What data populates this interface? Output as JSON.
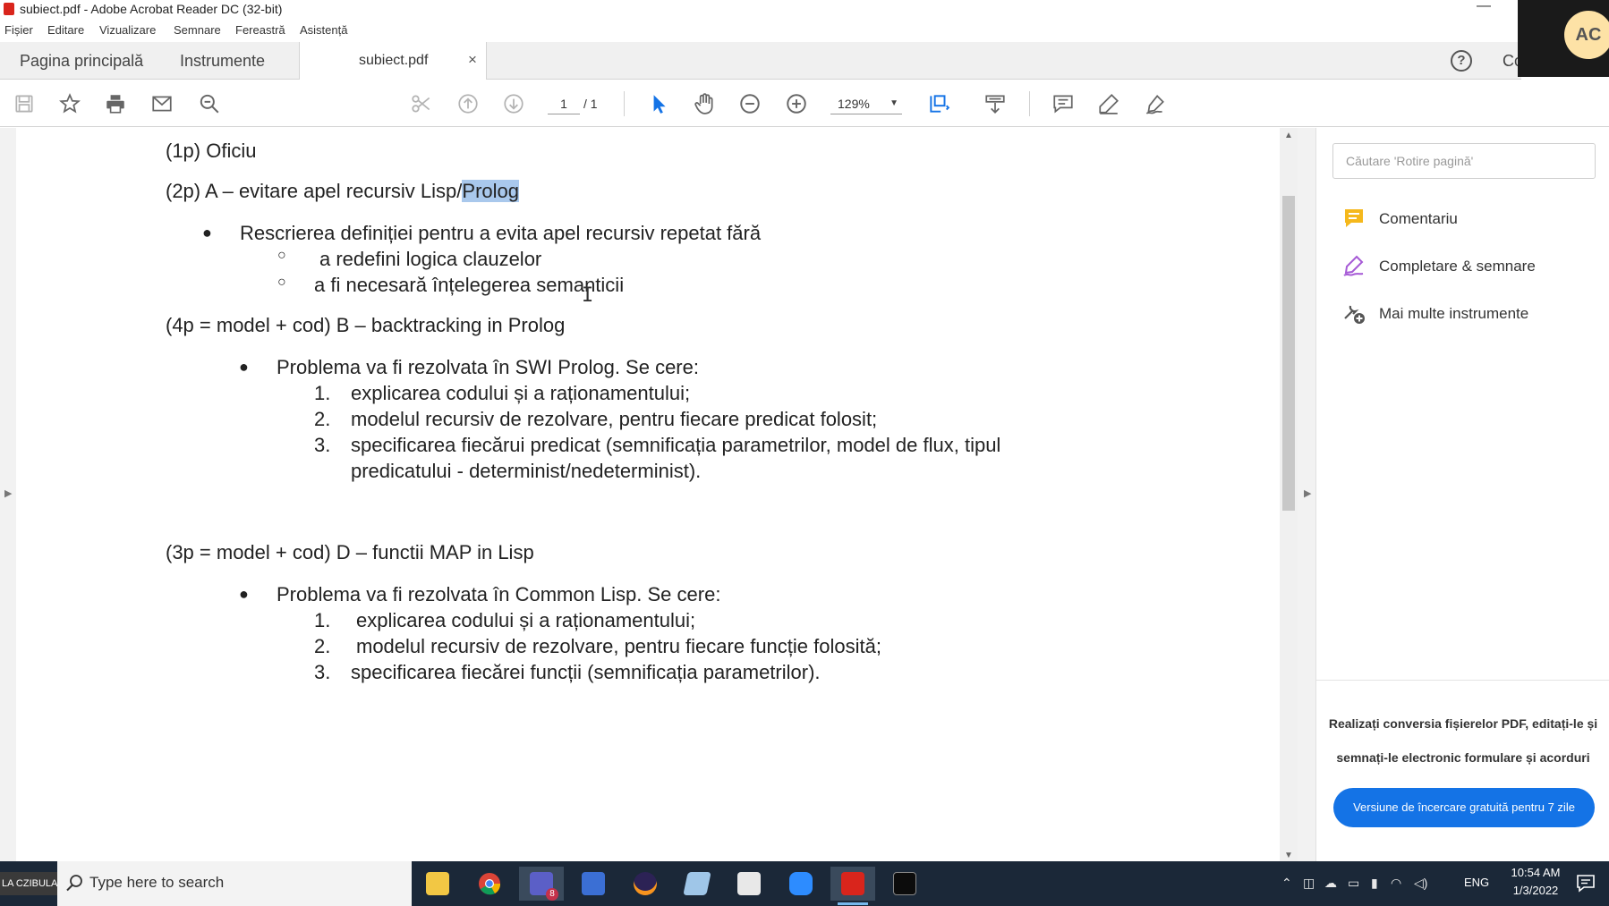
{
  "window": {
    "title": "subiect.pdf - Adobe Acrobat Reader DC (32-bit)",
    "minimize": "—"
  },
  "menu": [
    "Fișier",
    "Editare",
    "Vizualizare",
    "Semnare",
    "Fereastră",
    "Asistență"
  ],
  "tabs": {
    "home": "Pagina principală",
    "tools": "Instrumente",
    "document": "subiect.pdf",
    "close": "×",
    "overflow": "Co"
  },
  "help_icon": "?",
  "avatar_initials": "AC",
  "toolbar": {
    "icons": [
      "save-icon",
      "bookmark-star-icon",
      "print-icon",
      "email-icon",
      "search-zoom-icon",
      "scissors-icon",
      "page-up-icon",
      "page-down-icon",
      "select-cursor-icon",
      "hand-icon",
      "zoom-out-icon",
      "zoom-in-icon",
      "fit-page-icon",
      "scroll-mode-icon",
      "comment-icon",
      "highlight-pen-icon",
      "sign-icon"
    ],
    "page_current": "1",
    "page_total": "/ 1",
    "zoom": "129%",
    "accent": "#1473e6"
  },
  "document": {
    "lines": {
      "l1": "(1p) Oficiu",
      "l2_pre": "(2p) A – evitare apel recursiv Lisp/",
      "l2_hl": "Prolog",
      "l3": "Rescrierea definiției pentru a evita apel recursiv repetat fără",
      "l4": "a redefini logica clauzelor",
      "l5": "a fi necesară înțelegerea semanticii",
      "l6": "(4p =  model + cod) B – backtracking in Prolog",
      "l7": "Problema va fi rezolvata în SWI Prolog. Se cere:",
      "l8n": "1.",
      "l8": "explicarea codului și a raționamentului;",
      "l9n": "2.",
      "l9": "modelul recursiv de rezolvare, pentru fiecare predicat folosit;",
      "l10n": "3.",
      "l10": "specificarea fiecărui predicat (semnificația parametrilor, model de flux, tipul",
      "l11": "predicatului - determinist/nedeterminist).",
      "l12": "(3p = model + cod) D – functii MAP in Lisp",
      "l13": "Problema va fi rezolvata în Common Lisp. Se cere:",
      "l14n": "1.",
      "l14": "explicarea codului și a raționamentului;",
      "l15n": "2.",
      "l15": "modelul recursiv de rezolvare, pentru fiecare funcție folosită;",
      "l16n": "3.",
      "l16": "specificarea fiecărei funcții (semnificația parametrilor)."
    },
    "bullet": "●",
    "sub_bullet": "○",
    "cursor": "I"
  },
  "right_panel": {
    "search_placeholder": "Căutare 'Rotire pagină'",
    "tools": [
      "Comentariu",
      "Completare & semnare",
      "Mai multe instrumente"
    ],
    "promo_line1": "Realizați conversia fișierelor PDF, editați-le și",
    "promo_line2": "semnați-le electronic formulare și acorduri",
    "trial_button": "Versiune de încercare gratuită pentru 7 zile"
  },
  "taskbar": {
    "user_label": "LA CZIBULA",
    "search_placeholder": "Type here to search",
    "apps": [
      "file-explorer-icon",
      "chrome-icon",
      "teams-icon",
      "save-disk-icon",
      "eclipse-icon",
      "notes-icon",
      "photos-icon",
      "zoom-icon",
      "acrobat-icon",
      "terminal-icon"
    ],
    "teams_badge": "8",
    "language": "ENG",
    "time": "10:54 AM",
    "date": "1/3/2022"
  }
}
